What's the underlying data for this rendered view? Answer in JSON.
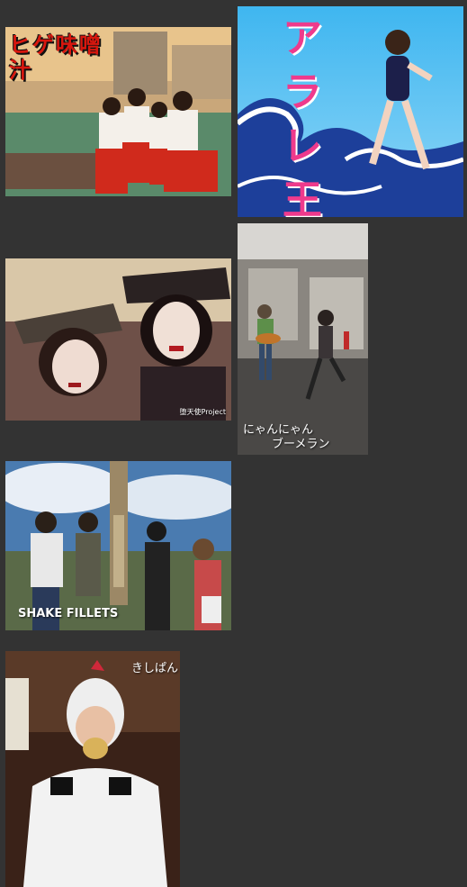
{
  "gallery": {
    "background_color": "#333333",
    "items": [
      {
        "id": "higeajimishiru",
        "logo_text": "ヒゲ味噌汁",
        "caption": ""
      },
      {
        "id": "arare-ou",
        "logo_text": "アラレ王",
        "caption": ""
      },
      {
        "id": "datenshi",
        "logo_text": "",
        "caption": "堕天使Project"
      },
      {
        "id": "nyannyan",
        "logo_text": "",
        "caption_line1": "にゃんにゃん",
        "caption_line2": "ブーメラン"
      },
      {
        "id": "shake-fillets",
        "logo_text": "",
        "caption": "SHAKE FILLETS"
      },
      {
        "id": "kishipan",
        "logo_text": "",
        "caption": "きしぱん"
      }
    ]
  }
}
